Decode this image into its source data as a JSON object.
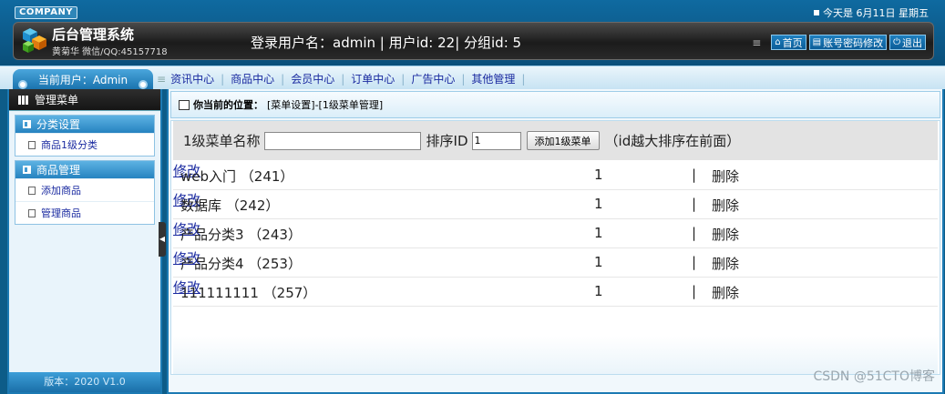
{
  "header": {
    "company_logo": "COMPANY",
    "date_text": "今天是 6月11日 星期五",
    "system_title": "后台管理系统",
    "author": "黄菊华 微信/QQ:45157718",
    "login_info": "登录用户名：admin | 用户id: 22| 分组id: 5",
    "buttons": [
      {
        "label": "首页",
        "icon": "home-icon"
      },
      {
        "label": "账号密码修改",
        "icon": "account-icon"
      },
      {
        "label": "退出",
        "icon": "power-icon"
      }
    ]
  },
  "nav": {
    "current_user": "当前用户：Admin",
    "items": [
      "资讯中心",
      "商品中心",
      "会员中心",
      "订单中心",
      "广告中心",
      "其他管理"
    ]
  },
  "sidebar": {
    "title": "管理菜单",
    "groups": [
      {
        "title": "分类设置",
        "items": [
          "商品1级分类"
        ]
      },
      {
        "title": "商品管理",
        "items": [
          "添加商品",
          "管理商品"
        ]
      }
    ],
    "version": "版本：2020 V1.0"
  },
  "main": {
    "location_label": "你当前的位置：",
    "location_path": "[菜单设置]-[1级菜单管理]",
    "form": {
      "name_label": "1级菜单名称",
      "name_value": "",
      "sort_label": "排序ID",
      "sort_value": "1",
      "add_button": "添加1级菜单",
      "hint": "（id越大排序在前面）"
    },
    "edit_label": "修改",
    "delete_label": "删除",
    "separator": "|",
    "rows": [
      {
        "name": "web入门 （241）",
        "sort": "1"
      },
      {
        "name": "数据库 （242）",
        "sort": "1"
      },
      {
        "name": "产品分类3 （243）",
        "sort": "1"
      },
      {
        "name": "产品分类4 （253）",
        "sort": "1"
      },
      {
        "name": "111111111 （257）",
        "sort": "1"
      }
    ]
  },
  "watermark": "CSDN @51CTO博客"
}
